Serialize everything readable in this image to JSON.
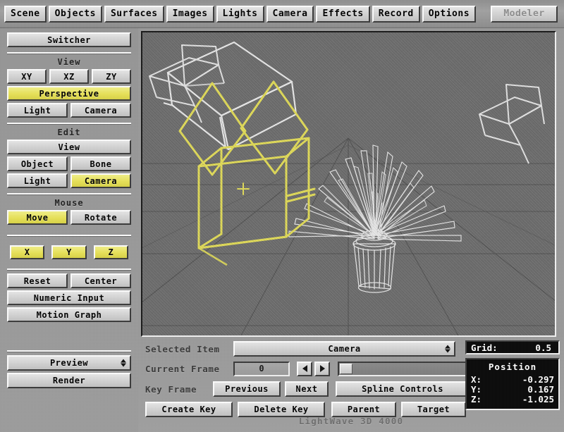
{
  "app": {
    "title": "LightWave 3D 4000",
    "status_text": "LightWave 3D 4000"
  },
  "topbar": {
    "items": [
      {
        "label": "Scene",
        "name": "menu-scene"
      },
      {
        "label": "Objects",
        "name": "menu-objects"
      },
      {
        "label": "Surfaces",
        "name": "menu-surfaces"
      },
      {
        "label": "Images",
        "name": "menu-images"
      },
      {
        "label": "Lights",
        "name": "menu-lights"
      },
      {
        "label": "Camera",
        "name": "menu-camera"
      },
      {
        "label": "Effects",
        "name": "menu-effects"
      },
      {
        "label": "Record",
        "name": "menu-record"
      },
      {
        "label": "Options",
        "name": "menu-options"
      }
    ],
    "modeler_label": "Modeler"
  },
  "sidebar": {
    "switcher_label": "Switcher",
    "view": {
      "group_label": "View",
      "xy": "XY",
      "xz": "XZ",
      "zy": "ZY",
      "perspective": "Perspective",
      "light": "Light",
      "camera": "Camera",
      "active": "Perspective"
    },
    "edit": {
      "group_label": "Edit",
      "view": "View",
      "object": "Object",
      "bone": "Bone",
      "light": "Light",
      "camera": "Camera",
      "active": "Camera"
    },
    "mouse": {
      "group_label": "Mouse",
      "move": "Move",
      "rotate": "Rotate",
      "active": "Move"
    },
    "axis": {
      "x": "X",
      "y": "Y",
      "z": "Z",
      "x_active": true,
      "y_active": true,
      "z_active": true
    },
    "actions": {
      "reset": "Reset",
      "center": "Center",
      "numeric_input": "Numeric Input",
      "motion_graph": "Motion Graph"
    },
    "render": {
      "preview": "Preview",
      "render": "Render"
    }
  },
  "bottom": {
    "selected_item_label": "Selected Item",
    "selected_item_value": "Camera",
    "current_frame_label": "Current Frame",
    "current_frame_value": "0",
    "prev_frame_icon": "triangle-left-icon",
    "next_frame_icon": "triangle-right-icon",
    "key_frame_label": "Key Frame",
    "previous": "Previous",
    "next": "Next",
    "spline_controls": "Spline Controls",
    "create_key": "Create Key",
    "delete_key": "Delete Key",
    "parent": "Parent",
    "target": "Target"
  },
  "info": {
    "grid_label": "Grid:",
    "grid_value": "0.5",
    "position_title": "Position",
    "position": [
      {
        "axis": "X:",
        "value": "-0.297"
      },
      {
        "axis": "Y:",
        "value": "0.167"
      },
      {
        "axis": "Z:",
        "value": "-1.025"
      }
    ]
  },
  "viewport": {
    "view_mode": "Perspective",
    "background_color": "#6f6f6f",
    "grid_line_color": "#4a4a4a",
    "selected_color": "#e8e259",
    "wireframe_color": "#f2f2f2",
    "objects": [
      {
        "name": "light-wireframe-box",
        "label": "Light",
        "color": "#f2f2f2"
      },
      {
        "name": "light-wireframe-cube",
        "label": "Light",
        "color": "#f2f2f2"
      },
      {
        "name": "plant-object",
        "label": "Potted Plant",
        "color": "#f2f2f2"
      },
      {
        "name": "camera-object",
        "label": "Camera",
        "color": "#e8e259",
        "selected": true
      }
    ]
  }
}
